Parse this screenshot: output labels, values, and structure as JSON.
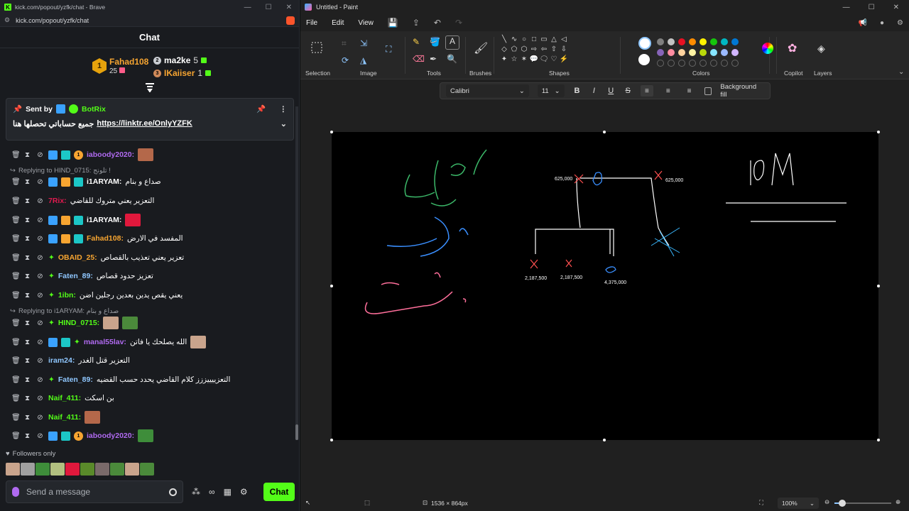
{
  "brave": {
    "tab_title": "kick.com/popout/yzfk/chat - Brave",
    "address": "kick.com/popout/yzfk/chat"
  },
  "chat": {
    "header": "Chat",
    "leaderboard": [
      {
        "rank": "1",
        "name": "Fahad108",
        "count": "25"
      },
      {
        "rank": "2",
        "name": "ma2ke",
        "count": "5"
      },
      {
        "rank": "3",
        "name": "IKaiiser",
        "count": "1"
      }
    ],
    "pinned": {
      "sent_by": "Sent by",
      "bot_name": "BotRix",
      "text_ar": "جميع حساباتي تحصلها هنا",
      "link": "https://linktr.ee/OnlyYZFK"
    },
    "messages": [
      {
        "user": "iaboody2020:",
        "text": "",
        "color": "#b06af0"
      },
      {
        "reply": "Replying to HIND_0715: تلونج !"
      },
      {
        "user": "i1ARYAM:",
        "text": "صداع و بنام",
        "color": "#ffffff"
      },
      {
        "user": "7Rix:",
        "text": "التعزير يعني متروك للقاضي",
        "color": "#e01a4f"
      },
      {
        "user": "i1ARYAM:",
        "text": "",
        "color": "#ffffff"
      },
      {
        "user": "Fahad108:",
        "text": "المفسد في الارض",
        "color": "#f7a531"
      },
      {
        "user": "OBAID_25:",
        "text": "تعزير يعني تعذيب بالقصاص",
        "color": "#f7a531"
      },
      {
        "user": "Faten_89:",
        "text": "تعزيز حدود قصاص",
        "color": "#8fc7ff"
      },
      {
        "user": "1ibn:",
        "text": "يعني يقص يدين بعدين رجلين اضن",
        "color": "#53fc18"
      },
      {
        "reply": "Replying to i1ARYAM: صداع و بنام"
      },
      {
        "user": "HIND_0715:",
        "text": "",
        "color": "#53fc18"
      },
      {
        "user": "manal55lav:",
        "text": "الله يصلحك يا فاتن",
        "color": "#b06af0"
      },
      {
        "user": "iram24:",
        "text": "التعزير قتل الغدر",
        "color": "#8fc7ff"
      },
      {
        "user": "Faten_89:",
        "text": "التعزييييززز كلام القاضي يحدد حسب القضيه",
        "color": "#8fc7ff"
      },
      {
        "user": "Naif_411:",
        "text": "بن اسكت",
        "color": "#53fc18"
      },
      {
        "user": "Naif_411:",
        "text": "",
        "color": "#53fc18"
      },
      {
        "user": "iaboody2020:",
        "text": "",
        "color": "#b06af0"
      }
    ],
    "followers_only": "Followers only",
    "input_placeholder": "Send a message",
    "chat_button": "Chat"
  },
  "paint": {
    "title": "Untitled - Paint",
    "menu": [
      "File",
      "Edit",
      "View"
    ],
    "groups": [
      "Selection",
      "Image",
      "Tools",
      "Brushes",
      "Shapes",
      "Colors",
      "Copilot",
      "Layers"
    ],
    "font": "Calibri",
    "font_size": "11",
    "background_fill": "Background fill",
    "canvas_size": "1536 × 864px",
    "zoom": "100%",
    "canvas_labels": [
      "625,000",
      "625,000",
      "2,187,500",
      "2,187,500",
      "4,375,000"
    ],
    "colors": [
      "#ffffff",
      "#000000",
      "#7f7f7f",
      "#c3c3c3",
      "#e81123",
      "#ff8c00",
      "#fff100",
      "#16c60c",
      "#00b7c3",
      "#0078d4",
      "#8764b8",
      "#ff8da1",
      "#ffd39f",
      "#fff4a3",
      "#bad80a",
      "#86e5ff",
      "#9ab9ff",
      "#d2b6ff"
    ]
  }
}
